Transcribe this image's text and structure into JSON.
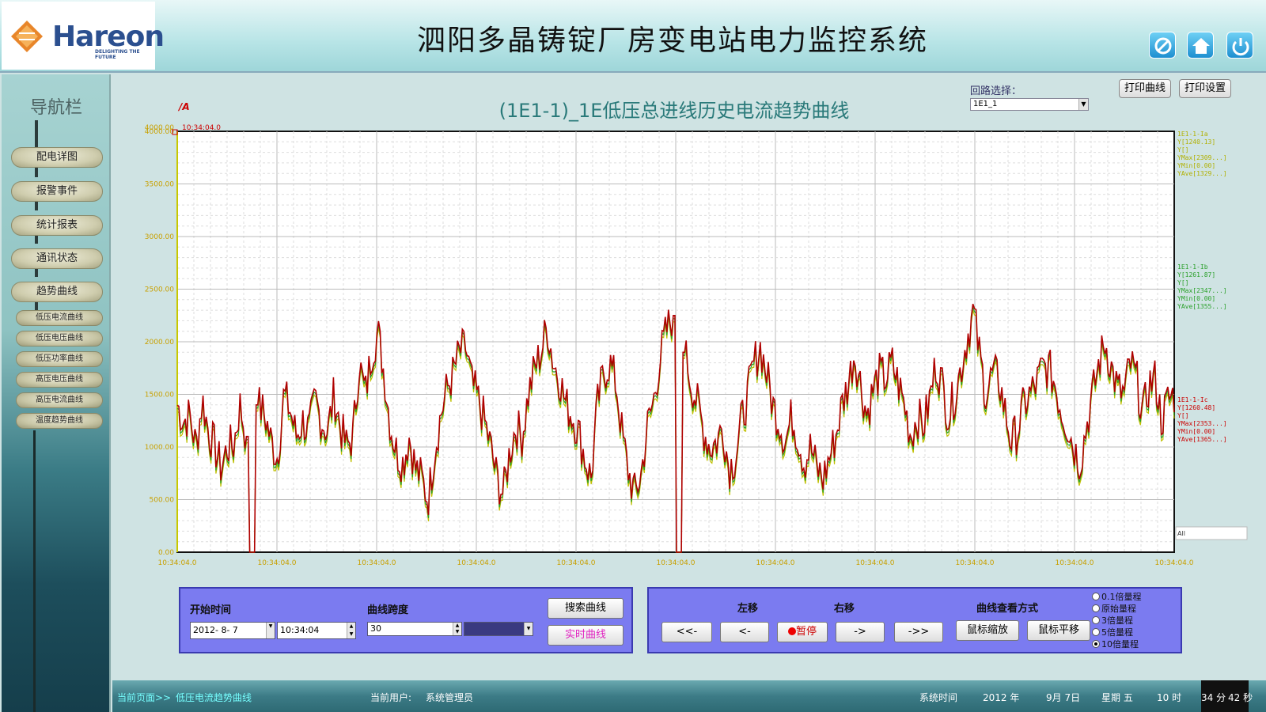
{
  "header": {
    "title": "泗阳多晶铸锭厂房变电站电力监控系统",
    "logo_text": "Hareon",
    "logo_tagline": "DELIGHTING THE FUTURE",
    "icons": [
      "cancel-icon",
      "home-icon",
      "power-icon"
    ]
  },
  "sidebar": {
    "title": "导航栏",
    "items": [
      "配电详图",
      "报警事件",
      "统计报表",
      "通讯状态",
      "趋势曲线"
    ],
    "sub_items": [
      "低压电流曲线",
      "低压电压曲线",
      "低压功率曲线",
      "高压电压曲线",
      "高压电流曲线",
      "温度趋势曲线"
    ]
  },
  "main": {
    "chart_title": "(1E1-1)_1E低压总进线历史电流趋势曲线",
    "unit": "/A",
    "loop_label": "回路选择：",
    "loop_value": "1E1_1",
    "print_curve": "打印曲线",
    "print_settings": "打印设置",
    "cursor_time": "10:34:04.0",
    "all_label": "All"
  },
  "chart_data": {
    "type": "line",
    "ylim": [
      0,
      4000
    ],
    "y_ticks": [
      "0.00",
      "500.00",
      "1000.00",
      "1500.00",
      "2000.00",
      "2500.00",
      "3000.00",
      "3500.00",
      "4000.00"
    ],
    "y_top_label": "4000.00",
    "x_ticks": [
      "10:34:04.0",
      "10:34:04.0",
      "10:34:04.0",
      "10:34:04.0",
      "10:34:04.0",
      "10:34:04.0",
      "10:34:04.0",
      "10:34:04.0",
      "10:34:04.0",
      "10:34:04.0",
      "10:34:04.0"
    ],
    "series": [
      {
        "name": "1E1-1-Ia",
        "color": "#c0c000",
        "legend": [
          "1E1-1-Ia",
          "Y[1240.13]",
          "Y[]",
          "YMax[2309...]",
          "YMin[0.00]",
          "YAve[1329...]"
        ]
      },
      {
        "name": "1E1-1-Ib",
        "color": "#2aa02a",
        "legend": [
          "1E1-1-Ib",
          "Y[1261.87]",
          "Y[]",
          "YMax[2347...]",
          "YMin[0.00]",
          "YAve[1355...]"
        ]
      },
      {
        "name": "1E1-1-Ic",
        "color": "#b00000",
        "legend": [
          "1E1-1-Ic",
          "Y[1260.48]",
          "Y[]",
          "YMax[2353...]",
          "YMin[0.00]",
          "YAve[1365...]"
        ]
      }
    ],
    "waveform_keyframes": [
      1400,
      1250,
      1300,
      1000,
      1450,
      1150,
      1000,
      800,
      1000,
      1020,
      1400,
      1100,
      0,
      1400,
      1300,
      1050,
      900,
      1500,
      1350,
      1100,
      1250,
      1150,
      1450,
      1250,
      1150,
      1500,
      1200,
      1000,
      1100,
      1800,
      1500,
      1900,
      2100,
      1700,
      1200,
      950,
      850,
      1100,
      800,
      700,
      500,
      950,
      1300,
      1550,
      1700,
      1900,
      1950,
      1600,
      1450,
      1250,
      1000,
      700,
      550,
      950,
      1200,
      1100,
      1500,
      1750,
      1900,
      2150,
      1800,
      1650,
      1400,
      1300,
      1150,
      900,
      700,
      1400,
      1700,
      1800,
      1600,
      1100,
      750,
      550,
      750,
      1200,
      1450,
      1850,
      2100,
      2250,
      0,
      1900,
      1600,
      1400,
      1150,
      1000,
      1050,
      1200,
      800,
      900,
      1250,
      1500,
      1800,
      1950,
      1700,
      1400,
      1250,
      1050,
      1300,
      1100,
      850,
      1000,
      800,
      700,
      900,
      1100,
      1400,
      1600,
      1900,
      1600,
      1300,
      1550,
      1700,
      1650,
      1800,
      1600,
      1400,
      1100,
      1300,
      1200,
      1450,
      1800,
      1600,
      1300,
      1500,
      1750,
      2050,
      2300,
      1850,
      1500,
      1700,
      1650,
      1350,
      1050,
      1150,
      1400,
      1500,
      1600,
      1750,
      1750,
      1600,
      1350,
      1200,
      1000,
      850,
      1200,
      1500,
      1800,
      2000,
      1750,
      1550,
      1500,
      1800,
      1650,
      1300,
      1600,
      1650,
      1250,
      1450,
      1500
    ]
  },
  "controls": {
    "start_time_label": "开始时间",
    "date_value": "2012- 8- 7",
    "time_value": "10:34:04",
    "span_label": "曲线跨度",
    "span_value": "30",
    "search_btn": "搜索曲线",
    "realtime_btn": "实时曲线",
    "left_label": "左移",
    "right_label": "右移",
    "view_label": "曲线查看方式",
    "btn_far_left": "<<-",
    "btn_left": "<-",
    "btn_pause": "暂停",
    "btn_right": "->",
    "btn_far_right": "->>",
    "btn_zoom": "鼠标缩放",
    "btn_pan": "鼠标平移",
    "radios": [
      "0.1倍量程",
      "原始量程",
      "3倍量程",
      "5倍量程",
      "10倍量程"
    ],
    "radio_selected": 4
  },
  "status": {
    "page_label": "当前页面>>",
    "page_value": "低压电流趋势曲线",
    "user_label": "当前用户:",
    "user_value": "系统管理员",
    "sys_time_label": "系统时间",
    "year": "2012 年",
    "month_day": "9月 7日",
    "weekday": "星期 五",
    "hour": "10 时",
    "minute": "34 分",
    "second": "42 秒"
  }
}
